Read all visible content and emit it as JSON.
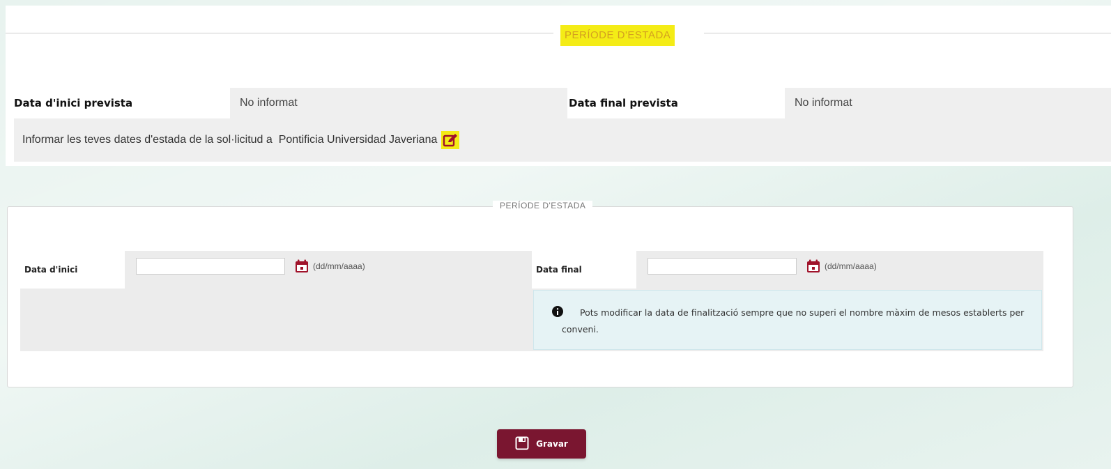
{
  "colors": {
    "accent_yellow": "#f4ec16",
    "title_text": "#d4a020",
    "brand_burgundy": "#7a1630",
    "cell_gray": "#efefef",
    "notice_bg": "#e6f3f5"
  },
  "stay_summary": {
    "section_title": "PERÍODE D'ESTADA",
    "start_label": "Data d'inici prevista",
    "start_value": "No informat",
    "end_label": "Data final prevista",
    "end_value": "No informat",
    "inform_text": "Informar les teves dates d'estada de la sol·licitud a  Pontificia Universidad Javeriana",
    "edit_icon": "edit-icon"
  },
  "stay_form": {
    "legend": "PERÍODE D'ESTADA",
    "start": {
      "label": "Data d'inici",
      "value": "",
      "format_hint": "(dd/mm/aaaa)",
      "icon": "calendar-icon"
    },
    "end": {
      "label": "Data final",
      "value": "",
      "format_hint": "(dd/mm/aaaa)",
      "icon": "calendar-icon"
    },
    "notice": {
      "icon": "info-icon",
      "text": "Pots modificar la data de finalització sempre que no superi el nombre màxim de mesos establerts per conveni."
    }
  },
  "actions": {
    "save_label": "Gravar",
    "save_icon": "save-icon"
  }
}
